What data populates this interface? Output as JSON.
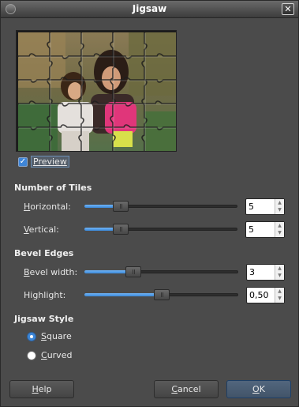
{
  "window": {
    "title": "Jigsaw"
  },
  "preview": {
    "label": "Preview",
    "checked": true
  },
  "tiles": {
    "heading": "Number of Tiles",
    "horizontal": {
      "label": "Horizontal:",
      "mnemonic": "H",
      "rest": "orizontal:",
      "value": "5",
      "fraction": 0.19
    },
    "vertical": {
      "label": "Vertical:",
      "mnemonic": "V",
      "rest": "ertical:",
      "value": "5",
      "fraction": 0.19
    }
  },
  "bevel": {
    "heading": "Bevel Edges",
    "width": {
      "label": "Bevel width:",
      "mnemonic": "B",
      "rest": "evel width:",
      "value": "3",
      "fraction": 0.27
    },
    "highlight": {
      "label": "Highlight:",
      "pre": "Hi",
      "mnemonic": "g",
      "rest": "hlight:",
      "value": "0,50",
      "fraction": 0.5
    }
  },
  "style": {
    "heading": "Jigsaw Style",
    "options": [
      {
        "label": "Square",
        "mnemonic": "S",
        "rest": "quare",
        "selected": true
      },
      {
        "label": "Curved",
        "mnemonic": "C",
        "rest": "urved",
        "selected": false
      }
    ]
  },
  "buttons": {
    "help": {
      "label": "Help",
      "mnemonic": "H",
      "rest": "elp"
    },
    "cancel": {
      "label": "Cancel",
      "mnemonic": "C",
      "rest": "ancel"
    },
    "ok": {
      "label": "OK",
      "mnemonic": "O",
      "rest": "K"
    }
  },
  "icons": {
    "close": "close-icon",
    "window": "window-menu-icon",
    "check": "checkmark-icon"
  },
  "colors": {
    "accent": "#3d87d8",
    "background": "#4b4b4b",
    "titlebar": "#3c3c3c"
  }
}
